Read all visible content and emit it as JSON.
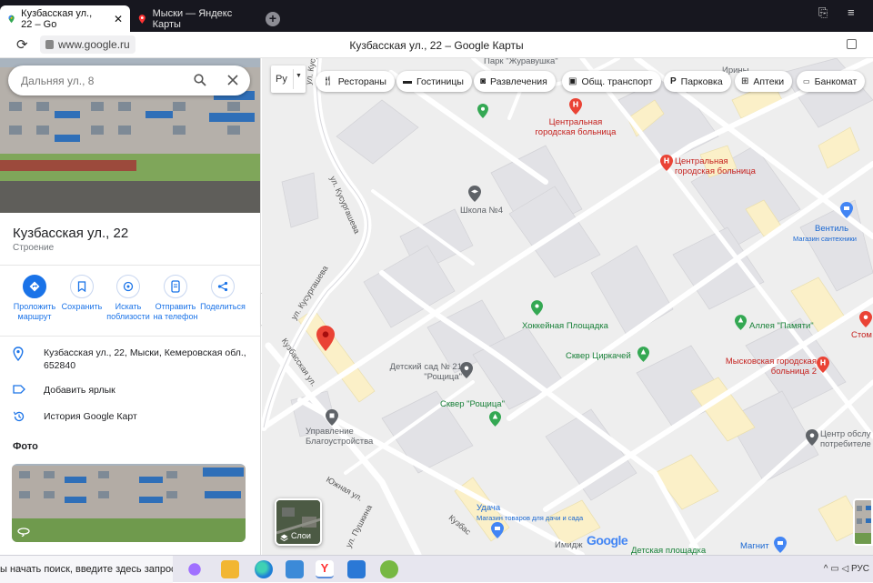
{
  "browser": {
    "tabs": [
      {
        "title": "Кузбасская ул., 22 – Go",
        "close": "✕",
        "active": true
      },
      {
        "title": "Мыски — Яндекс Карты",
        "active": false
      }
    ],
    "new_tab": "+",
    "url": "www.google.ru",
    "page_title": "Кузбасская ул., 22 – Google Карты"
  },
  "panel": {
    "search": {
      "placeholder": "Дальняя ул., 8"
    },
    "place_title": "Кузбасская ул., 22",
    "place_type": "Строение",
    "actions": [
      {
        "label": "Проложить маршрут",
        "icon": "directions-icon"
      },
      {
        "label": "Сохранить",
        "icon": "bookmark-icon"
      },
      {
        "label": "Искать поблизости",
        "icon": "nearby-icon"
      },
      {
        "label": "Отправить на телефон",
        "icon": "send-to-phone-icon"
      },
      {
        "label": "Поделиться",
        "icon": "share-icon"
      }
    ],
    "address": "Кузбасская ул., 22, Мыски, Кемеровская обл., 652840",
    "add_label": "Добавить ярлык",
    "history": "История Google Карт",
    "photos_heading": "Фото"
  },
  "map": {
    "lang_selector": "Ру",
    "chips": [
      {
        "label": "Рестораны",
        "icon": "fork-knife-icon"
      },
      {
        "label": "Гостиницы",
        "icon": "bed-icon"
      },
      {
        "label": "Развлечения",
        "icon": "camera-icon"
      },
      {
        "label": "Общ. транспорт",
        "icon": "bus-icon"
      },
      {
        "label": "Парковка",
        "icon": "parking-icon"
      },
      {
        "label": "Аптеки",
        "icon": "pharmacy-icon"
      },
      {
        "label": "Банкомат",
        "icon": "atm-icon"
      }
    ],
    "pois": {
      "park_top": "Парк \"Журавушка\"",
      "hospital1": "Центральная городская больница",
      "hospital2": "Центральная городская больница",
      "school": "Школа №4",
      "ventil": "Вентиль",
      "ventil_sub": "Магазин сантехники",
      "hockey": "Хоккейная Площадка",
      "alley": "Аллея \"Памяти\"",
      "stom": "Стом",
      "kindergarten": "Детский сад № 21 \"Рощица\"",
      "circus_square": "Сквер Циркачей",
      "hospital3": "Мысковская городская больница 2",
      "roshchitsa_square": "Сквер \"Рощица\"",
      "management": "Управление Благоустройства",
      "service_center": "Центр обслу потребителе",
      "udacha": "Удача",
      "udacha_sub": "Магазин товаров для дачи и сада",
      "magnit": "Магнит",
      "playground": "Детская площадка",
      "imidzh": "Имидж",
      "iriny": "Ирины"
    },
    "roads": {
      "kusurgasheva1": "ул. Кусургашева",
      "kusurgasheva2": "ул. Кусургашева",
      "kusurgasheva3": "ул. Кусургашева",
      "kuzbasskaya1": "Кузбасская ул.",
      "kuzbasskaya2": "Кузбас",
      "yuzhnaya": "Южная ул.",
      "pushkina": "ул. Пушкина"
    },
    "layers_label": "Слои",
    "google_logo": "Google"
  },
  "taskbar": {
    "search_placeholder": "ы начать поиск, введите здесь запрос",
    "tray_lang": "РУС"
  },
  "colors": {
    "tab_bg": "#17171f",
    "accent_blue": "#1a73e8",
    "poi_red": "#ea4335",
    "poi_green": "#34a853",
    "poi_grey": "#5f6368",
    "map_bg": "#eeeeee",
    "building_yellow": "#fbf0c8"
  }
}
